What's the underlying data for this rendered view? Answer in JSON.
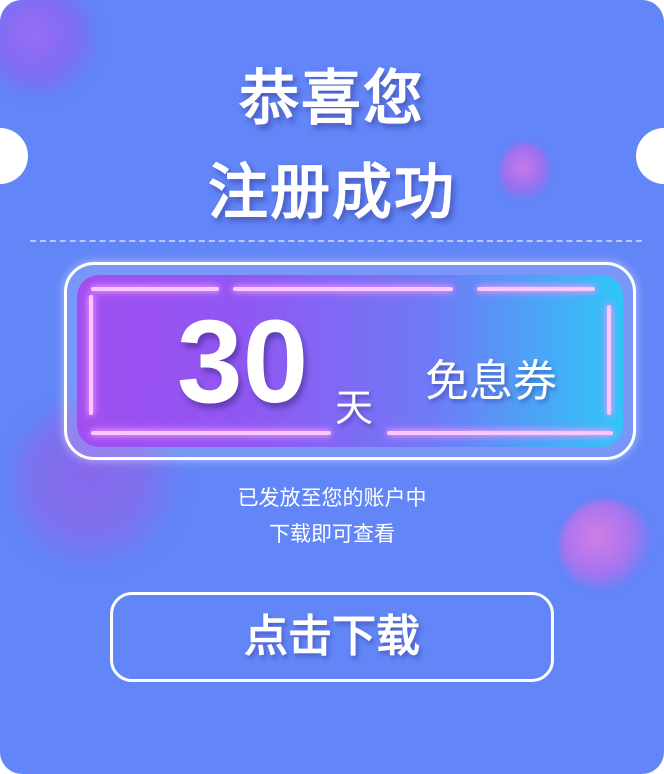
{
  "header": {
    "title_line1": "恭喜您",
    "title_line2": "注册成功"
  },
  "coupon": {
    "amount": "30",
    "unit": "天",
    "type": "免息券"
  },
  "message": {
    "line1": "已发放至您的账户中",
    "line2": "下载即可查看"
  },
  "actions": {
    "download_label": "点击下载"
  },
  "colors": {
    "background": "#6285f8",
    "coupon_gradient_start": "#a04ef0",
    "coupon_gradient_end": "#2ec7f7",
    "neon_accent": "#f8c8ff",
    "text": "#ffffff"
  }
}
